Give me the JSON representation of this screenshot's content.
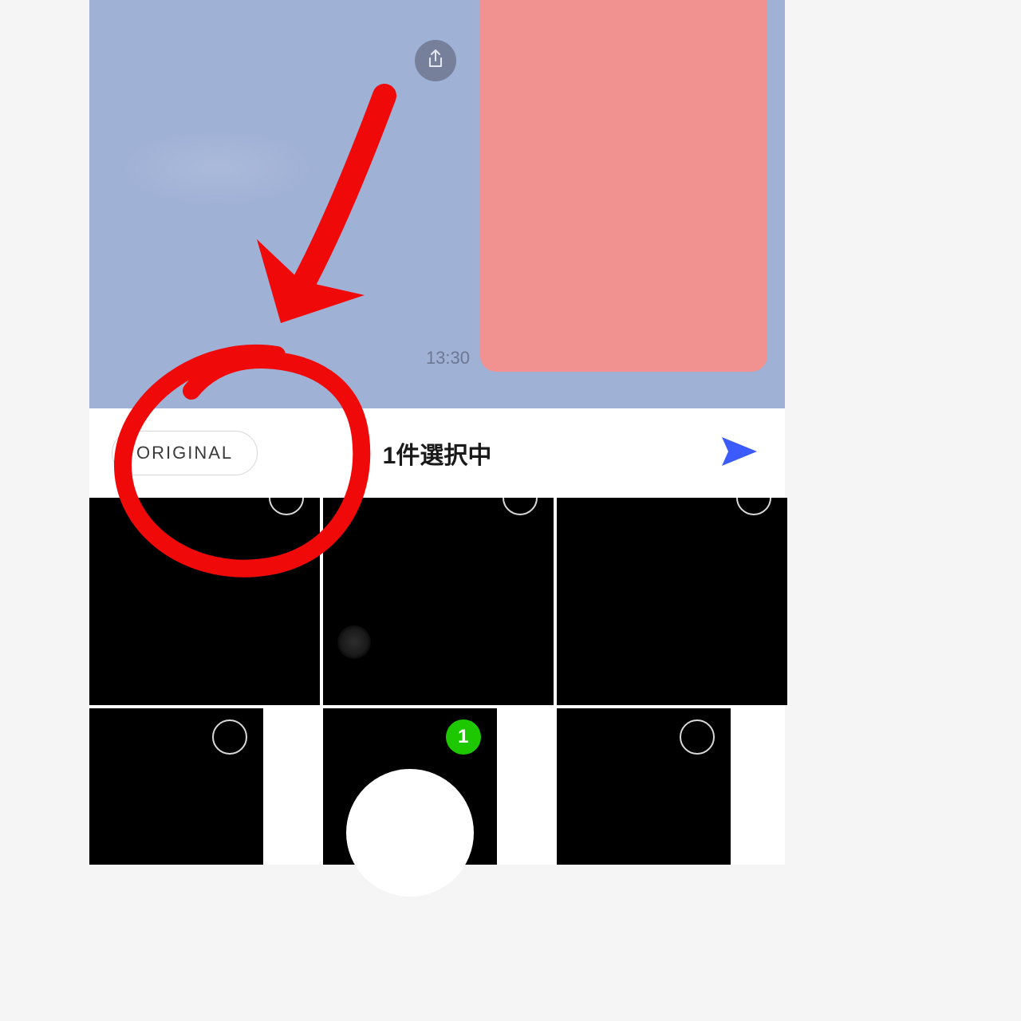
{
  "chat": {
    "timestamp": "13:30",
    "share_icon": "share-icon"
  },
  "picker": {
    "original_label": "ORIGINAL",
    "selection_label": "1件選択中",
    "send_icon": "send-icon"
  },
  "grid": {
    "selected_index": 4,
    "selected_badge": "1"
  },
  "colors": {
    "chat_bg": "#a0b1d6",
    "msg_bg": "#f29290",
    "send": "#3b5bff",
    "badge": "#1ec800",
    "annotation": "#ef0909"
  }
}
